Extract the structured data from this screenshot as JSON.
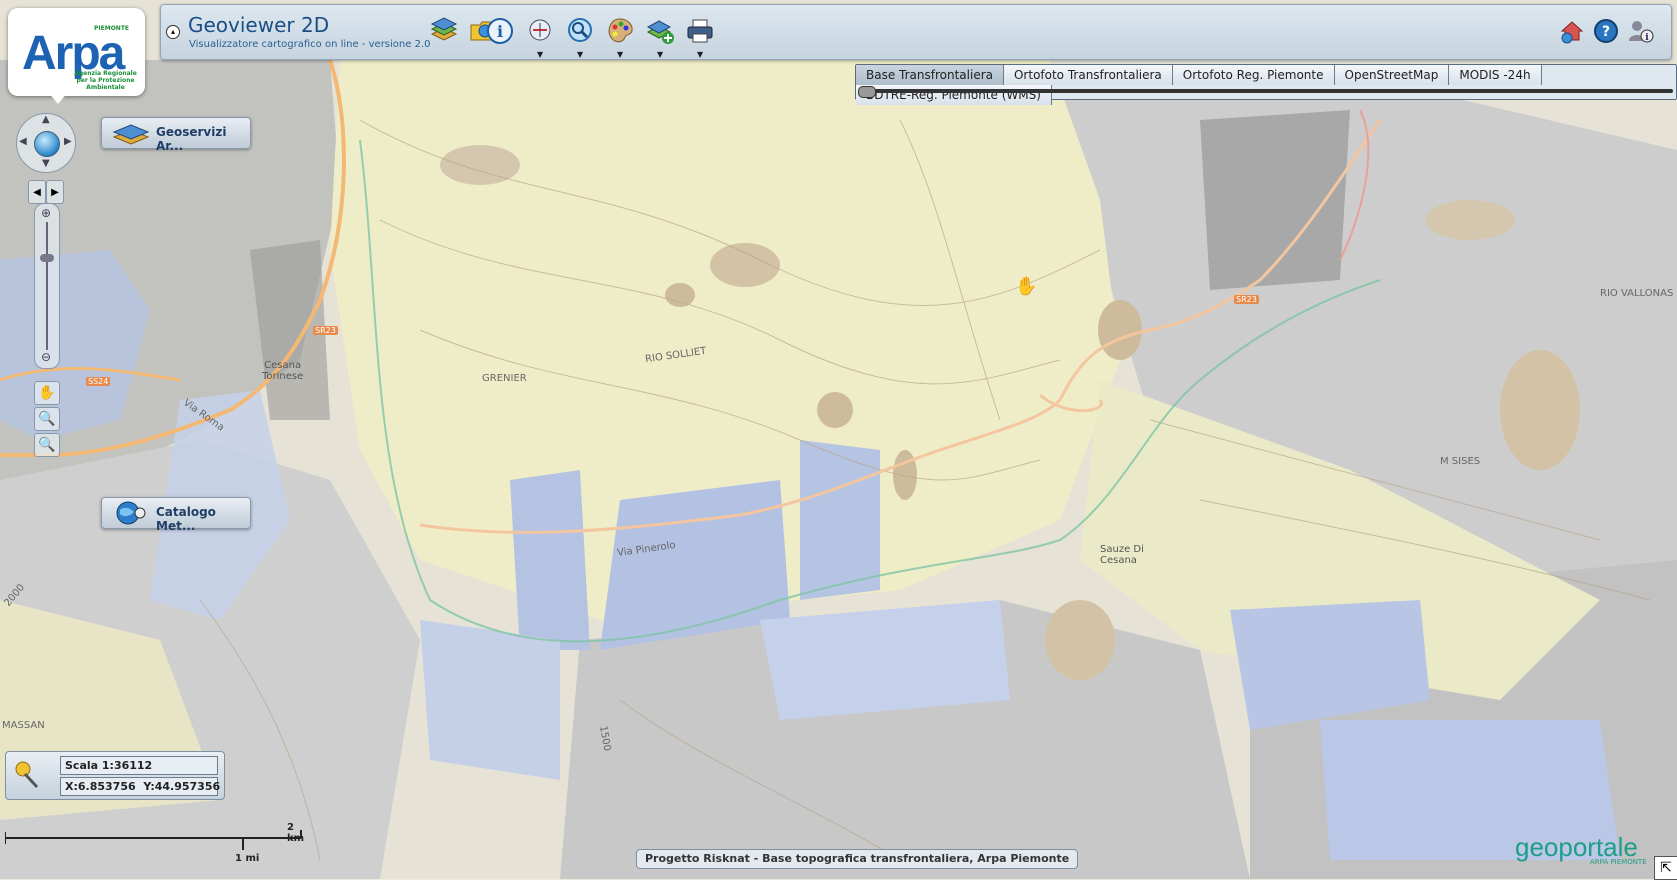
{
  "header": {
    "title": "Geoviewer 2D",
    "subtitle": "Visualizzatore cartografico on line - versione 2.0",
    "collapse_glyph": "▴",
    "toolbar": [
      {
        "icon": "layers-icon"
      },
      {
        "icon": "folder-map-icon"
      },
      {
        "icon": "info-icon"
      },
      {
        "icon": "measure-icon",
        "has_menu": true
      },
      {
        "icon": "search-icon",
        "has_menu": true
      },
      {
        "icon": "palette-icon",
        "has_menu": true
      },
      {
        "icon": "add-layer-icon",
        "has_menu": true
      },
      {
        "icon": "print-icon",
        "has_menu": true
      }
    ],
    "right_icons": [
      "home-icon",
      "help-icon",
      "user-info-icon"
    ]
  },
  "logo": {
    "text": "Arpa",
    "region": "PIEMONTE",
    "tagline": "Agenzia Regionale per la Protezione Ambientale"
  },
  "layer_switcher": {
    "tabs": [
      {
        "label": "Base Transfrontaliera",
        "active": true
      },
      {
        "label": "Ortofoto Transfrontaliera",
        "active": false
      },
      {
        "label": "Ortofoto Reg. Piemonte",
        "active": false
      },
      {
        "label": "OpenStreetMap",
        "active": false
      },
      {
        "label": "MODIS -24h",
        "active": false
      },
      {
        "label": "BDTRE-Reg. Piemonte (WMS)",
        "active": false
      }
    ],
    "opacity": 0
  },
  "side_panels": {
    "geoservizi": "Geoservizi Ar...",
    "catalogo": "Catalogo Met..."
  },
  "coords": {
    "scale": "Scala 1:36112",
    "x": "X:6.853756",
    "y": "Y:44.957356"
  },
  "scalebar": {
    "km": "2 km",
    "mi": "1 mi"
  },
  "attribution": "Progetto Risknat - Base topografica transfrontaliera, Arpa Piemonte",
  "geoportale": {
    "name": "geoportale",
    "sub": "ARPA PIEMONTE"
  },
  "map_labels": {
    "cesana": "Cesana\nTorinese",
    "sauze": "Sauze Di\nCesana",
    "sises": "M SISES",
    "via_pinerolo": "Via Pinerolo",
    "via_roma": "Via Roma",
    "sr23": "SR23",
    "ss24": "SS24",
    "sr23b": "SR23",
    "massan": "MASSAN",
    "rio_solluet": "RIO SOLLIET",
    "grenier": "GRENIER",
    "rio_vallonas": "RIO VALLONAS",
    "elev_1500": "1500",
    "elev_2000": "2000"
  },
  "zoom_level": 0.28
}
